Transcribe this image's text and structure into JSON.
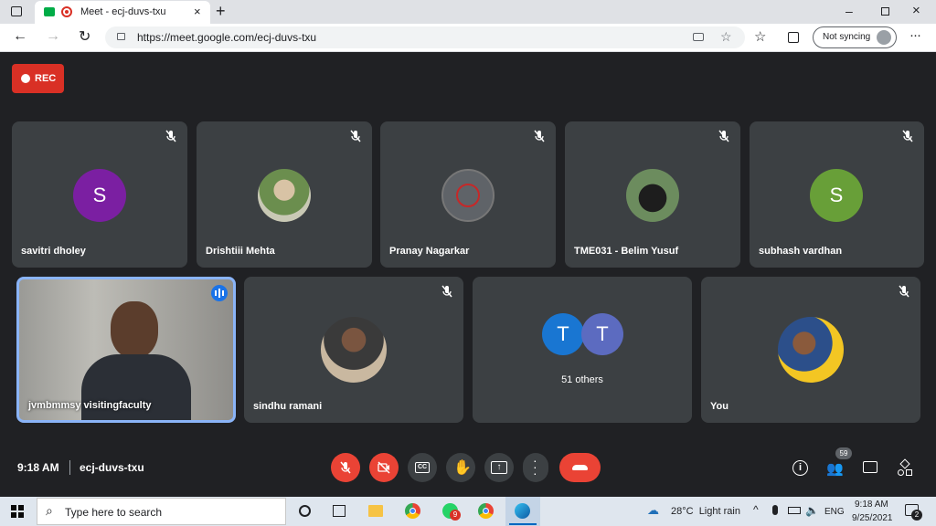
{
  "browser": {
    "tab_title": "Meet - ecj-duvs-txu",
    "url": "https://meet.google.com/ecj-duvs-txu",
    "sync_label": "Not syncing"
  },
  "meet": {
    "rec_label": "REC",
    "time": "9:18 AM",
    "meeting_code": "ecj-duvs-txu",
    "participants_badge": "59",
    "tiles_row1": [
      {
        "name": "savitri dholey",
        "initial": "S",
        "color": "#7b1fa2"
      },
      {
        "name": "Drishtiii Mehta",
        "initial": "",
        "color": "#9e9e9e"
      },
      {
        "name": "Pranay Nagarkar",
        "initial": "",
        "color": "#5f6368"
      },
      {
        "name": "TME031 - Belim Yusuf",
        "initial": "",
        "color": "#4e5b4e"
      },
      {
        "name": "subhash vardhan",
        "initial": "S",
        "color": "#689f38"
      }
    ],
    "tiles_row2": [
      {
        "name": "jvmbmmsy visitingfaculty"
      },
      {
        "name": "sindhu ramani"
      },
      {
        "others_initial1": "T",
        "others_initial2": "T",
        "others_label": "51 others"
      },
      {
        "name": "You"
      }
    ]
  },
  "taskbar": {
    "search_placeholder": "Type here to search",
    "weather": "28°C  Light rain",
    "lang": "ENG",
    "time": "9:18 AM",
    "date": "9/25/2021",
    "whatsapp_badge": "9",
    "notif_badge": "2"
  }
}
